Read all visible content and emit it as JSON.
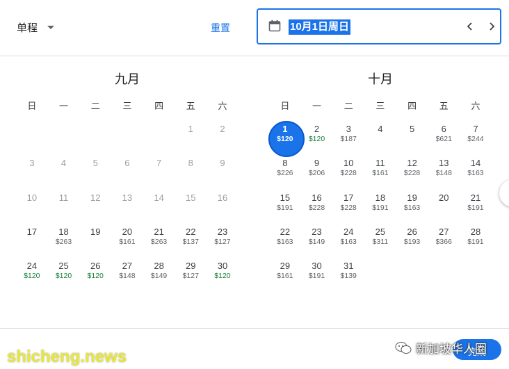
{
  "header": {
    "trip_type": "单程",
    "reset_label": "重置",
    "date_value": "10月1日周日"
  },
  "calendar": {
    "weekdays": [
      "日",
      "一",
      "二",
      "三",
      "四",
      "五",
      "六"
    ],
    "months": [
      {
        "title": "九月",
        "cells": [
          null,
          null,
          null,
          null,
          null,
          {
            "day": "1",
            "price": "",
            "disabled": true
          },
          {
            "day": "2",
            "price": "",
            "disabled": true
          },
          {
            "day": "3",
            "price": "",
            "disabled": true
          },
          {
            "day": "4",
            "price": "",
            "disabled": true
          },
          {
            "day": "5",
            "price": "",
            "disabled": true
          },
          {
            "day": "6",
            "price": "",
            "disabled": true
          },
          {
            "day": "7",
            "price": "",
            "disabled": true
          },
          {
            "day": "8",
            "price": "",
            "disabled": true
          },
          {
            "day": "9",
            "price": "",
            "disabled": true
          },
          {
            "day": "10",
            "price": "",
            "disabled": true
          },
          {
            "day": "11",
            "price": "",
            "disabled": true
          },
          {
            "day": "12",
            "price": "",
            "disabled": true
          },
          {
            "day": "13",
            "price": "",
            "disabled": true
          },
          {
            "day": "14",
            "price": "",
            "disabled": true
          },
          {
            "day": "15",
            "price": "",
            "disabled": true
          },
          {
            "day": "16",
            "price": "",
            "disabled": true
          },
          {
            "day": "17",
            "price": ""
          },
          {
            "day": "18",
            "price": "$263"
          },
          {
            "day": "19",
            "price": ""
          },
          {
            "day": "20",
            "price": "$161"
          },
          {
            "day": "21",
            "price": "$263"
          },
          {
            "day": "22",
            "price": "$137"
          },
          {
            "day": "23",
            "price": "$127"
          },
          {
            "day": "24",
            "price": "$120",
            "cheap": true
          },
          {
            "day": "25",
            "price": "$120",
            "cheap": true
          },
          {
            "day": "26",
            "price": "$120",
            "cheap": true
          },
          {
            "day": "27",
            "price": "$148"
          },
          {
            "day": "28",
            "price": "$149"
          },
          {
            "day": "29",
            "price": "$127"
          },
          {
            "day": "30",
            "price": "$120",
            "cheap": true
          }
        ]
      },
      {
        "title": "十月",
        "cells": [
          {
            "day": "1",
            "price": "$120",
            "selected": true
          },
          {
            "day": "2",
            "price": "$120",
            "cheap": true
          },
          {
            "day": "3",
            "price": "$187"
          },
          {
            "day": "4",
            "price": ""
          },
          {
            "day": "5",
            "price": ""
          },
          {
            "day": "6",
            "price": "$621"
          },
          {
            "day": "7",
            "price": "$244"
          },
          {
            "day": "8",
            "price": "$226"
          },
          {
            "day": "9",
            "price": "$206"
          },
          {
            "day": "10",
            "price": "$228"
          },
          {
            "day": "11",
            "price": "$161"
          },
          {
            "day": "12",
            "price": "$228"
          },
          {
            "day": "13",
            "price": "$148"
          },
          {
            "day": "14",
            "price": "$163"
          },
          {
            "day": "15",
            "price": "$191"
          },
          {
            "day": "16",
            "price": "$228"
          },
          {
            "day": "17",
            "price": "$228"
          },
          {
            "day": "18",
            "price": "$191"
          },
          {
            "day": "19",
            "price": "$163"
          },
          {
            "day": "20",
            "price": ""
          },
          {
            "day": "21",
            "price": "$191"
          },
          {
            "day": "22",
            "price": "$163"
          },
          {
            "day": "23",
            "price": "$149"
          },
          {
            "day": "24",
            "price": "$163"
          },
          {
            "day": "25",
            "price": "$311"
          },
          {
            "day": "26",
            "price": "$193"
          },
          {
            "day": "27",
            "price": "$366"
          },
          {
            "day": "28",
            "price": "$191"
          },
          {
            "day": "29",
            "price": "$161"
          },
          {
            "day": "30",
            "price": "$191"
          },
          {
            "day": "31",
            "price": "$139"
          }
        ]
      }
    ]
  },
  "footer": {
    "done_label": "完成"
  },
  "watermarks": {
    "left": "shicheng.news",
    "right": "新加坡华人圈"
  },
  "colors": {
    "accent": "#1a73e8",
    "cheap_price": "#188038",
    "disabled_day": "#9aa0a6"
  },
  "icons": [
    "dropdown-caret-icon",
    "calendar-icon",
    "chevron-left-icon",
    "chevron-right-icon",
    "wechat-icon"
  ]
}
